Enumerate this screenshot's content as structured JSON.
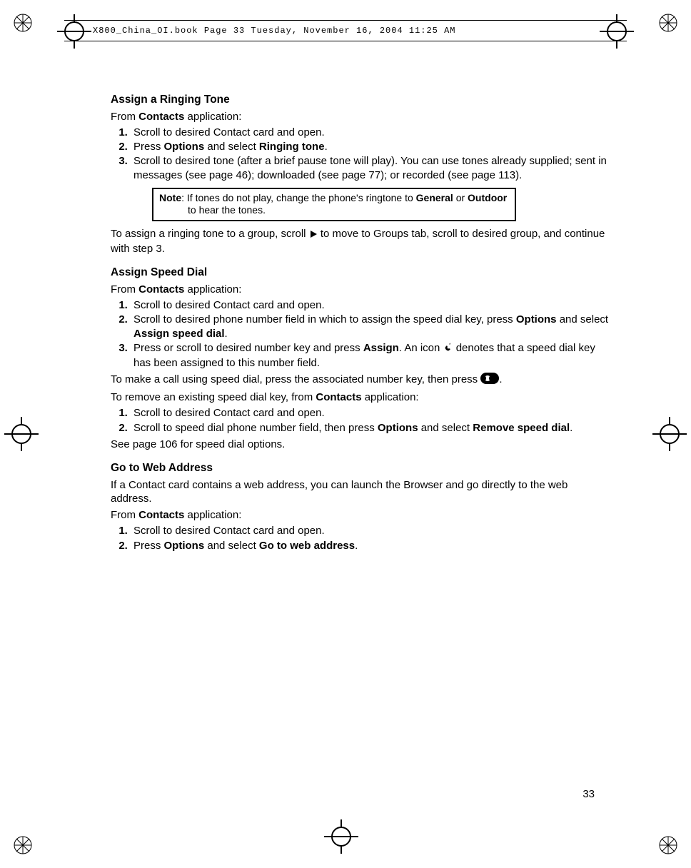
{
  "header": {
    "filename_line": "X800_China_OI.book  Page 33  Tuesday, November 16, 2004  11:25 AM"
  },
  "page_number": "33",
  "s1": {
    "heading": "Assign a Ringing Tone",
    "intro_pre": "From ",
    "intro_bold": "Contacts",
    "intro_post": " application:",
    "li1": "Scroll to desired Contact card and open.",
    "li2_pre": "Press ",
    "li2_b1": "Options",
    "li2_mid": " and select ",
    "li2_b2": "Ringing tone",
    "li2_post": ".",
    "li3": "Scroll to desired tone (after a brief pause tone will play). You can use tones already supplied; sent in messages (see page 46); downloaded (see page 77); or recorded (see page 113).",
    "note_label": "Note",
    "note_pre": ": If tones do not play, change the phone's ringtone to ",
    "note_b1": "General",
    "note_mid": " or ",
    "note_b2": "Outdoor",
    "note_post": " to hear the tones.",
    "after_note_pre": "To assign a ringing tone to a group, scroll ",
    "after_note_post": " to move to Groups tab, scroll to desired group, and continue with step 3."
  },
  "s2": {
    "heading": "Assign Speed Dial",
    "intro_pre": "From ",
    "intro_bold": "Contacts",
    "intro_post": " application:",
    "li1": "Scroll to desired Contact card and open.",
    "li2_pre": "Scroll to desired phone number field in which to assign the speed dial key, press ",
    "li2_b1": "Options",
    "li2_mid": " and select ",
    "li2_b2": "Assign speed dial",
    "li2_post": ".",
    "li3_pre": "Press or scroll to desired number key and press ",
    "li3_b1": "Assign",
    "li3_mid": ". An icon ",
    "li3_post": " denotes that a speed dial key has been assigned to this number field.",
    "call_pre": "To make a call using speed dial, press the associated number key, then press ",
    "call_post": ".",
    "remove_intro_pre": "To remove an existing speed dial key, from ",
    "remove_intro_bold": "Contacts",
    "remove_intro_post": " application:",
    "r_li1": "Scroll to desired Contact card and open.",
    "r_li2_pre": "Scroll to speed dial phone number field, then press ",
    "r_li2_b1": "Options",
    "r_li2_mid": " and select ",
    "r_li2_b2": "Remove speed dial",
    "r_li2_post": ".",
    "footer": "See page 106 for speed dial options."
  },
  "s3": {
    "heading": "Go to Web Address",
    "intro": "If a Contact card contains a web address, you can launch the Browser and go directly to the web address.",
    "from_pre": "From ",
    "from_bold": "Contacts",
    "from_post": " application:",
    "li1": "Scroll to desired Contact card and open.",
    "li2_pre": "Press ",
    "li2_b1": "Options",
    "li2_mid": " and select ",
    "li2_b2": "Go to web address",
    "li2_post": "."
  }
}
